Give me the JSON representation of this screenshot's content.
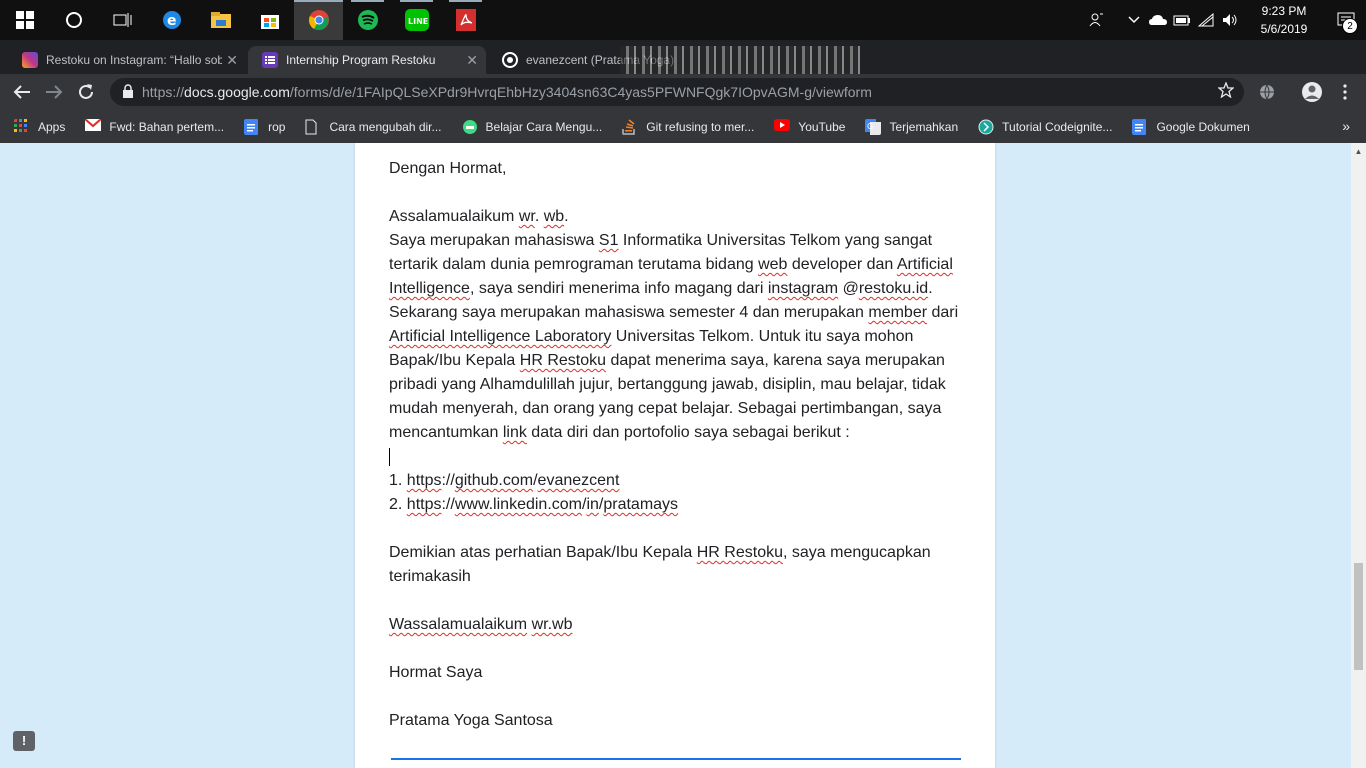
{
  "taskbar": {
    "clock_time": "9:23 PM",
    "clock_date": "5/6/2019",
    "notification_count": "2"
  },
  "tabs": [
    {
      "title": "Restoku on Instagram: “Hallo sob",
      "active": false,
      "favicon_color": "#c13584"
    },
    {
      "title": "Internship Program Restoku",
      "active": true,
      "favicon_color": "#673ab7"
    },
    {
      "title": "evanezcent (Pratama Yoga)",
      "active": false,
      "favicon_color": "#ffffff"
    }
  ],
  "address": {
    "scheme": "https://",
    "host": "docs.google.com",
    "path": "/forms/d/e/1FAIpQLSeXPdr9HvrqEhbHzy3404sn63C4yas5PFWNFQgk7IOpvAGM-g/viewform"
  },
  "bookmarks": [
    {
      "label": "Apps",
      "icon": "apps-grid-icon",
      "color": "#ea4335"
    },
    {
      "label": "Fwd: Bahan pertem...",
      "icon": "gmail-icon",
      "color": "#d93025"
    },
    {
      "label": "rop",
      "icon": "google-docs-icon",
      "color": "#4285f4"
    },
    {
      "label": "Cara mengubah dir...",
      "icon": "page-icon",
      "color": "#e8eaed"
    },
    {
      "label": "Belajar Cara Mengu...",
      "icon": "android-icon",
      "color": "#3ddc84"
    },
    {
      "label": "Git refusing to mer...",
      "icon": "stackoverflow-icon",
      "color": "#f48024"
    },
    {
      "label": "YouTube",
      "icon": "youtube-icon",
      "color": "#ff0000"
    },
    {
      "label": "Terjemahkan",
      "icon": "google-translate-icon",
      "color": "#4285f4"
    },
    {
      "label": "Tutorial Codeignite...",
      "icon": "codeigniter-icon",
      "color": "#19a89d"
    },
    {
      "label": "Google Dokumen",
      "icon": "google-docs-icon",
      "color": "#4285f4"
    }
  ],
  "letter": {
    "greeting": "Dengan Hormat,",
    "salam_a": "Assalamualaikum ",
    "salam_b": "wr",
    "salam_c": ". ",
    "salam_d": "wb",
    "salam_e": ".",
    "body_1": "Saya merupakan mahasiswa ",
    "body_2": "S1",
    "body_3": " Informatika Universitas Telkom yang sangat tertarik dalam dunia pemrograman terutama bidang ",
    "body_4": "web",
    "body_5": " developer dan ",
    "body_6": "Artificial Intelligence",
    "body_7": ", saya sendiri menerima info magang dari ",
    "body_8": "instagram",
    "body_9": " @",
    "body_10": "restoku.id",
    "body_11": ". Sekarang saya merupakan mahasiswa semester 4 dan merupakan ",
    "body_12": "member",
    "body_13": " dari ",
    "body_14": "Artificial Intelligence Laboratory",
    "body_15": " Universitas Telkom. Untuk itu saya mohon Bapak/Ibu Kepala ",
    "body_16": "HR Restoku",
    "body_17": " dapat menerima saya, karena saya merupakan pribadi yang Alhamdulillah jujur, bertanggung jawab, disiplin, mau belajar, tidak mudah menyerah, dan orang yang cepat belajar. Sebagai pertimbangan, saya mencantumkan ",
    "body_18": "link",
    "body_19": " data diri dan portofolio saya sebagai berikut :",
    "link1_num": "1. ",
    "link1_a": "https",
    "link1_b": "://",
    "link1_c": "github.com",
    "link1_d": "/",
    "link1_e": "evanezcent",
    "link2_num": "2. ",
    "link2_a": "https",
    "link2_b": "://",
    "link2_c": "www.linkedin.com",
    "link2_d": "/",
    "link2_e": "in",
    "link2_f": "/",
    "link2_g": "pratamays",
    "closing_1": "Demikian atas perhatian Bapak/Ibu Kepala ",
    "closing_2": "HR Restoku",
    "closing_3": ", saya mengucapkan terimakasih",
    "wassalam_a": "Wassalamualaikum",
    "wassalam_b": " ",
    "wassalam_c": "wr.wb",
    "signoff": "Hormat Saya",
    "name": "Pratama Yoga Santosa"
  }
}
